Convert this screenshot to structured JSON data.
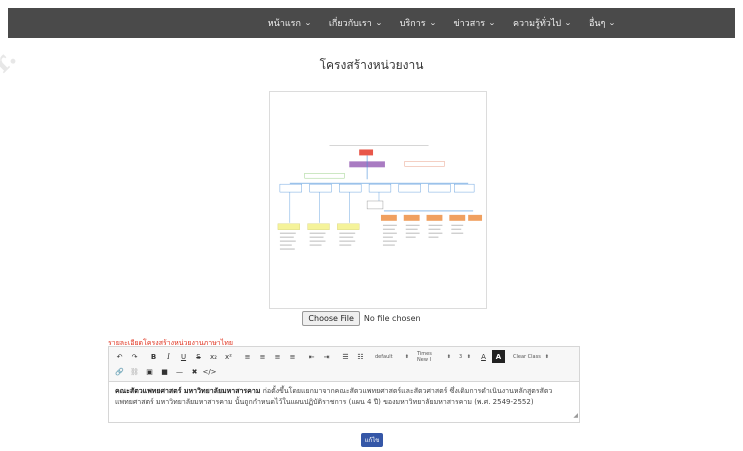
{
  "nav": {
    "items": [
      {
        "label": "หน้าแรก"
      },
      {
        "label": "เกี่ยวกับเรา"
      },
      {
        "label": "บริการ"
      },
      {
        "label": "ข่าวสาร"
      },
      {
        "label": "ความรู้ทั่วไป"
      },
      {
        "label": "อื่นๆ"
      }
    ],
    "chevron_icon": "chevron-down-icon"
  },
  "page": {
    "title": "โครงสร้างหน่วยงาน"
  },
  "file_input": {
    "button_label": "Choose File",
    "status": "No file chosen"
  },
  "section": {
    "label": "รายละเอียดโครงสร้างหน่วยงานภาษาไทย"
  },
  "editor": {
    "toolbar": {
      "undo": "↶",
      "redo": "↷",
      "bold": "B",
      "italic": "I",
      "underline": "U",
      "strike": "S",
      "subscript": "x₂",
      "superscript": "x²",
      "align_left": "≡",
      "align_center": "≡",
      "align_right": "≡",
      "justify": "≡",
      "outdent": "⇤",
      "indent": "⇥",
      "unordered_list": "☰",
      "ordered_list": "☷",
      "style_select": "default",
      "font_select": "Times New I",
      "size_select": "3",
      "font_color": "A",
      "bg_color": "A",
      "class_select": "Clear Class",
      "link": "🔗",
      "unlink": "⛓",
      "image": "▣",
      "video": "■",
      "hr": "—",
      "clear_format": "✖",
      "code": "</>"
    },
    "content": {
      "strong_text": "คณะสัตวแพทยศาสตร์ มหาวิทยาลัยมหาสารคาม",
      "body_text": " ก่อตั้งขึ้นโดยแยกมาจากคณะสัตวแพทยศาสตร์และสัตวศาสตร์ ซึ่งเดิมการดำเนินงานหลักสูตรสัตวแพทยศาสตร์ มหาวิทยาลัยมหาสารคาม นั้นถูกกำหนดไว้ในแผนปฏิบัติราชการ (แผน 4 ปี) ของมหาวิทยาลัยมหาสารคาม (พ.ศ. 2549-2552)"
    }
  },
  "save_button": {
    "label": "แก้ไข"
  },
  "colors": {
    "navbar": "#4a4a4a",
    "accent_red": "#e0331f",
    "button_blue": "#3557a7"
  }
}
